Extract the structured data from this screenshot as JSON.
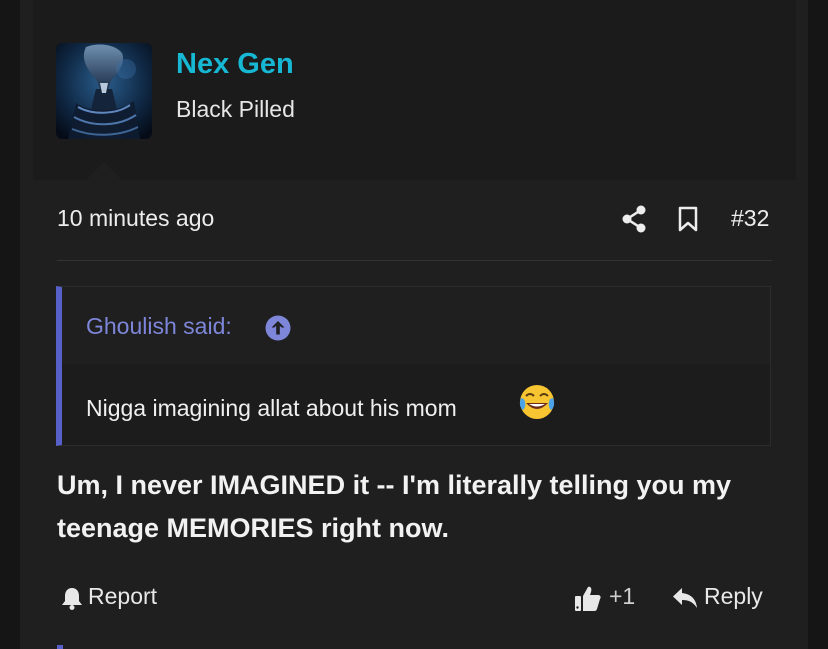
{
  "post": {
    "user": {
      "name": "Nex Gen",
      "title": "Black Pilled",
      "avatar_icon": "alien-avatar"
    },
    "meta": {
      "time_ago": "10 minutes ago",
      "post_number": "#32",
      "share_icon": "share-icon",
      "bookmark_icon": "bookmark-icon"
    },
    "quote": {
      "author_label": "Ghoulish said:",
      "text": "Nigga imagining allat about his mom",
      "emoji": "face-with-tears-of-joy",
      "accent_color": "#5660c8"
    },
    "body": "Um, I never IMAGINED it -- I'm literally telling you my teenage MEMORIES right now.",
    "actions": {
      "report_label": "Report",
      "like_count": "+1",
      "reply_label": "Reply"
    }
  },
  "colors": {
    "username": "#16b8d3",
    "quote_link": "#7d86d9",
    "background": "#1f1f1f"
  }
}
